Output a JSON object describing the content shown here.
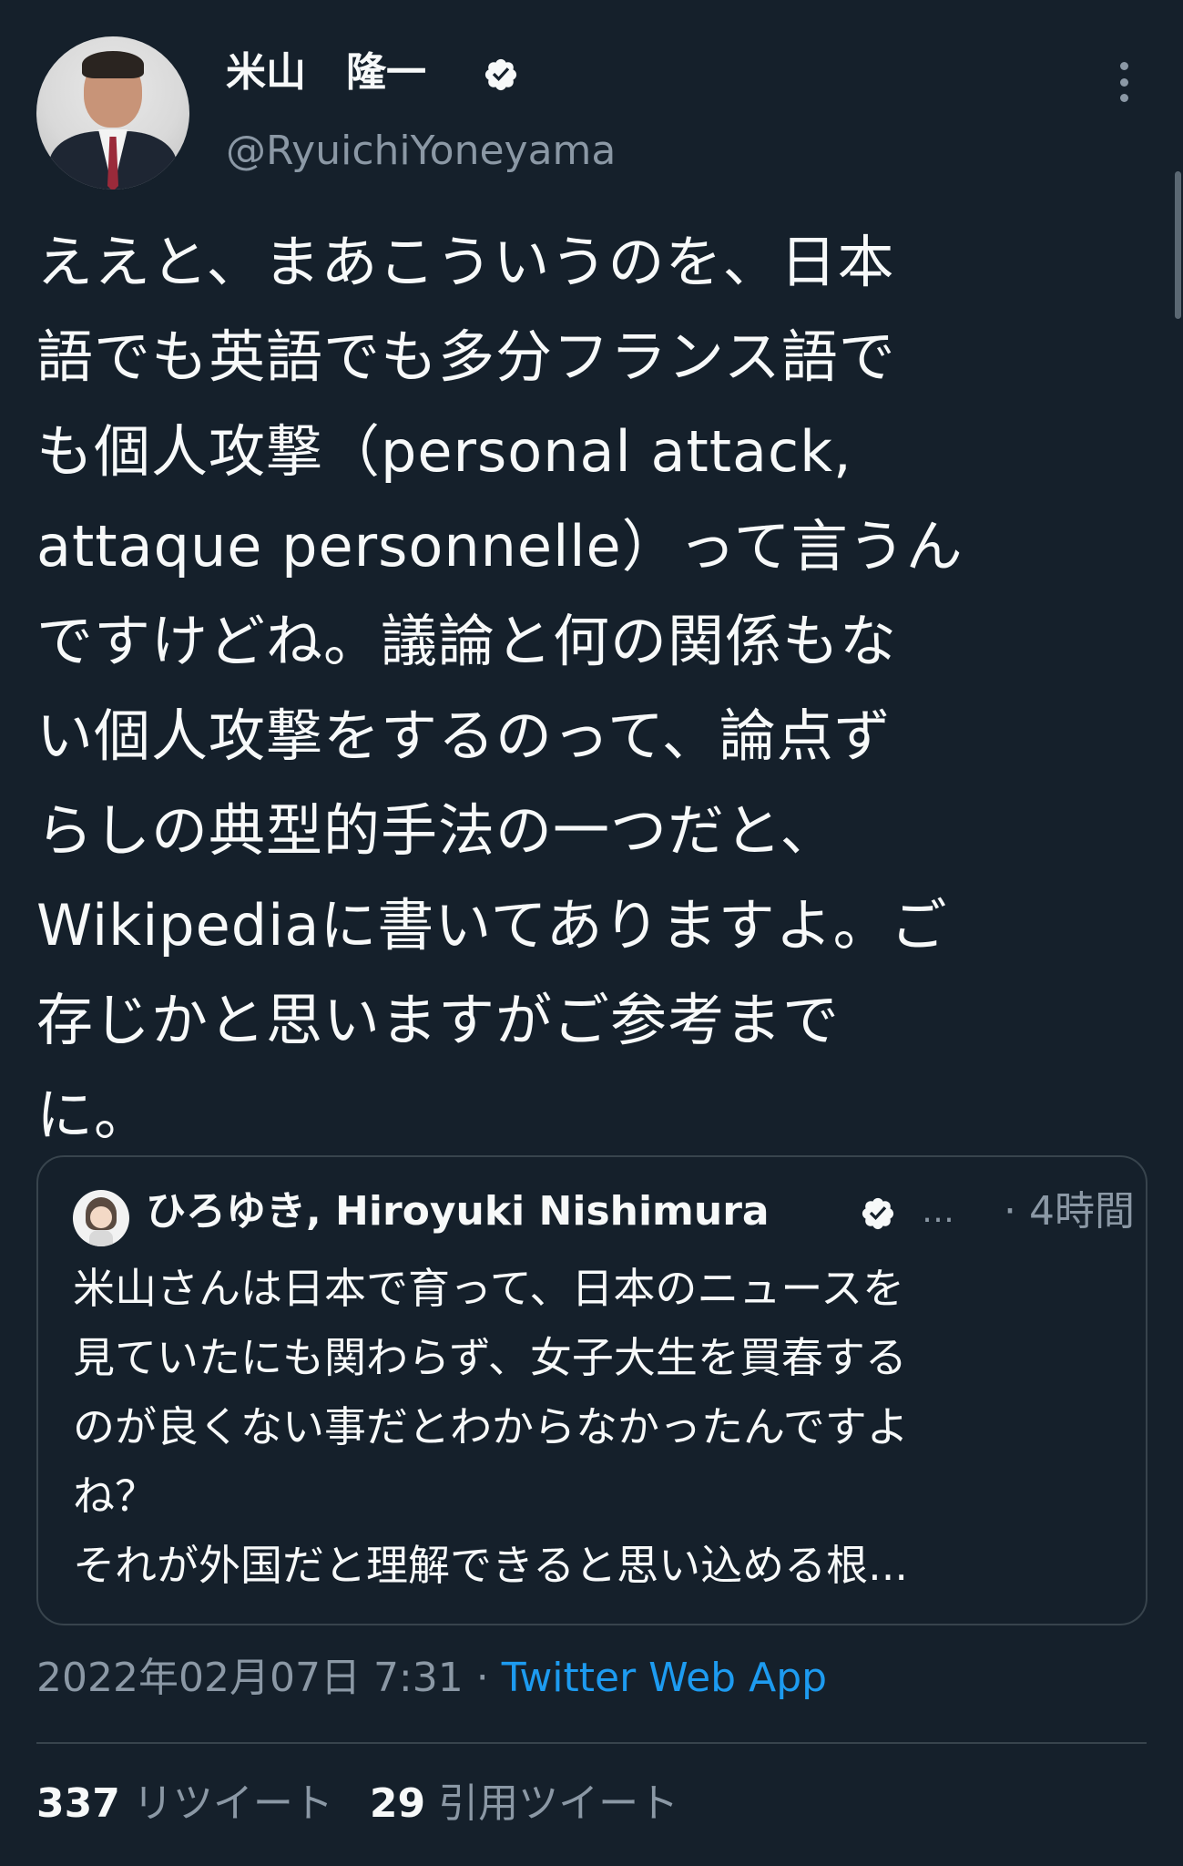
{
  "author": {
    "name": "米山　隆一",
    "handle": "@RyuichiYoneyama",
    "verified": true
  },
  "tweet": {
    "text": "ええと、まあこういうのを、日本\n語でも英語でも多分フランス語で\nも個人攻撃（personal attack,\nattaque personnelle）って言うん\nですけどね。議論と何の関係もな\nい個人攻撃をするのって、論点ず\nらしの典型的手法の一つだと、\nWikipediaに書いてありますよ。ご\n存じかと思いますがご参考まで\nに。"
  },
  "quoted_tweet": {
    "name": "ひろゆき, Hiroyuki Nishimura",
    "ellipsis": "…",
    "time": "· 4時間",
    "text": "米山さんは日本で育って、日本のニュースを\n見ていたにも関わらず、女子大生を買春する\nのが良くない事だとわからなかったんですよ\nね？\nそれが外国だと理解できると思い込める根..."
  },
  "meta": {
    "datetime": "2022年02月07日 7:31",
    "separator": " · ",
    "source": "Twitter Web App"
  },
  "stats": {
    "retweets": "337",
    "retweets_label": "リツイート",
    "quotes": "29",
    "quotes_label": "引用ツイート"
  },
  "colors": {
    "background": "#15202b",
    "text": "#f7f9f9",
    "secondary": "#8b98a5",
    "link": "#1d9bf0",
    "border": "#38444d"
  },
  "icons": [
    "verified-badge-icon",
    "more-options-icon"
  ]
}
